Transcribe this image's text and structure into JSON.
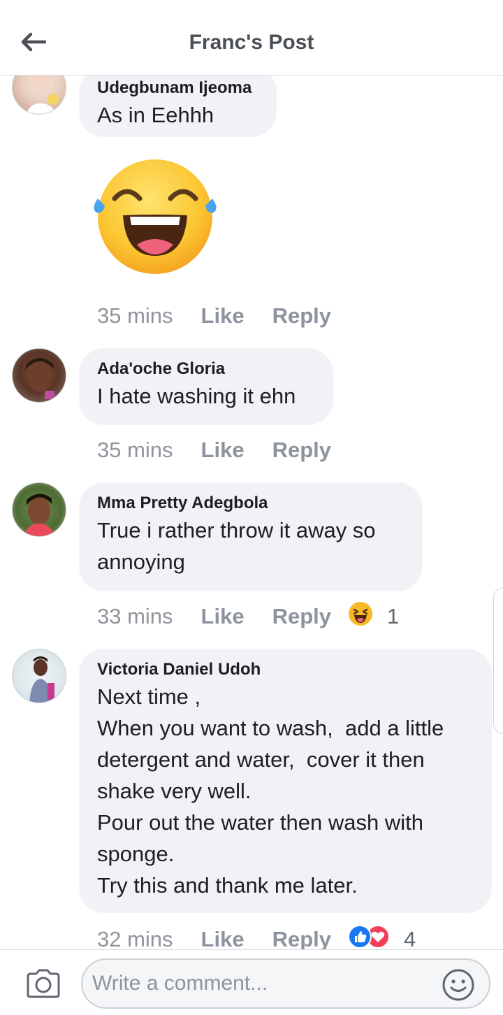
{
  "header": {
    "title": "Franc's Post"
  },
  "comments": [
    {
      "author": "Udegbunam Ijeoma",
      "text": "As in Eehhh",
      "sticker": "laughing-tears-emoji",
      "time": "35 mins",
      "like_label": "Like",
      "reply_label": "Reply"
    },
    {
      "author": "Ada'oche Gloria",
      "text": "I hate washing it ehn",
      "time": "35 mins",
      "like_label": "Like",
      "reply_label": "Reply"
    },
    {
      "author": "Mma Pretty Adegbola",
      "text": "True i rather throw it away so\nannoying",
      "time": "33 mins",
      "like_label": "Like",
      "reply_label": "Reply",
      "reactions": [
        "haha-icon"
      ],
      "reaction_count": "1"
    },
    {
      "author": "Victoria Daniel Udoh",
      "text": "Next time ,\nWhen you want to wash,  add a little\ndetergent and water,  cover it then\nshake very well.\nPour out the water then wash with\nsponge.\nTry this and thank me later.",
      "time": "32 mins",
      "like_label": "Like",
      "reply_label": "Reply",
      "reactions": [
        "like-icon",
        "love-icon"
      ],
      "reaction_count": "4"
    }
  ],
  "composer": {
    "placeholder": "Write a comment..."
  },
  "colors": {
    "bubble": "#f0f2f5",
    "meta_text": "#8d949e",
    "like_blue": "#1877f2",
    "love_red": "#f33e58",
    "haha_yellow": "#f7b928"
  }
}
